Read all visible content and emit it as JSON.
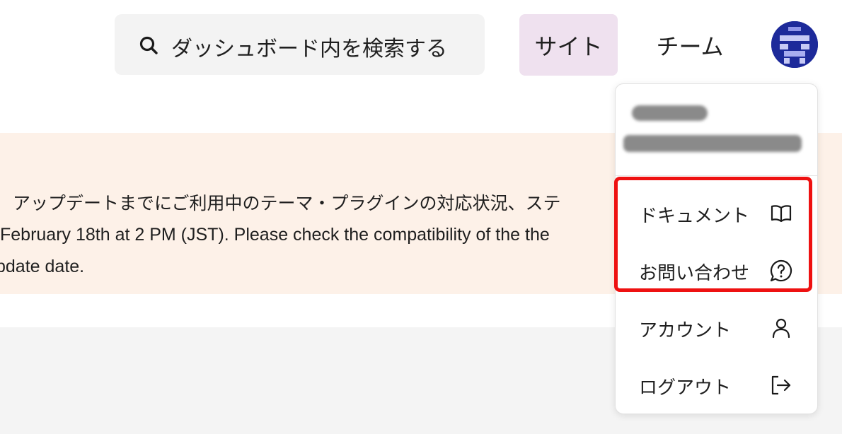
{
  "header": {
    "search": {
      "label": "ダッシュボード内を検索する",
      "icon": "search-icon"
    },
    "nav": [
      {
        "label": "サイト",
        "active": true
      },
      {
        "label": "チーム",
        "active": false
      }
    ],
    "avatar": {
      "icon": "pixel-avatar-icon",
      "color": "#1d2a9a"
    }
  },
  "notice": {
    "line1": "アップデートまでにご利用中のテーマ・プラグインの対応状況、ステ",
    "line2": "February 18th at 2 PM (JST). Please check the compatibility of the the",
    "line3": "pdate date.",
    "background": "#fdf1e8"
  },
  "user_menu": {
    "items": [
      {
        "label": "ドキュメント",
        "icon": "book-open-icon"
      },
      {
        "label": "お問い合わせ",
        "icon": "help-chat-icon"
      },
      {
        "label": "アカウント",
        "icon": "user-icon"
      },
      {
        "label": "ログアウト",
        "icon": "logout-icon"
      }
    ]
  },
  "colors": {
    "site_tab_bg": "#efe1ef",
    "search_bg": "#f3f3f3",
    "highlight_border": "#ee1111"
  }
}
